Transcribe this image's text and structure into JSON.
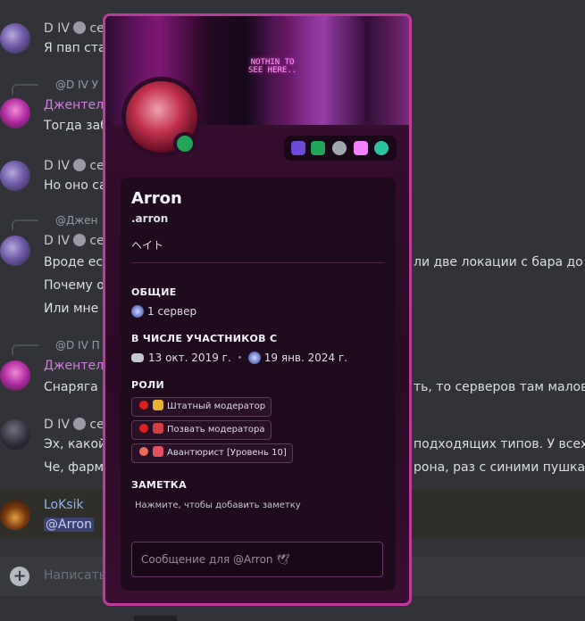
{
  "chat": {
    "messages": [
      {
        "user": "D IV",
        "suffix": "се",
        "text": "Я пвп ста"
      },
      {
        "reply": "@D IV У",
        "user": "Джентель",
        "text": "Тогда заб"
      },
      {
        "user": "D IV",
        "suffix": "се",
        "text": "Но оно са"
      },
      {
        "reply": "@Джен",
        "user": "D IV",
        "suffix": "се",
        "lines": [
          "Вроде ест",
          "Почему о",
          "Или мне н"
        ],
        "right_text": "ли две локации с бара до м"
      },
      {
        "reply": "@D IV П",
        "user": "Джентель",
        "text": "Снаряга с",
        "right_text": "ть, то серверов там маловат"
      },
      {
        "user": "D IV",
        "suffix": "се",
        "lines": [
          "Эх, какой",
          "Че, фарми"
        ],
        "right_lines": [
          "подходящих типов. У всех с",
          "рона, раз с синими пушками"
        ]
      },
      {
        "user": "LoKsik",
        "mention": "@Arron"
      }
    ],
    "composer_placeholder": "Написать"
  },
  "profile": {
    "banner_text": "NOTHIN TO\nSEE HERE..",
    "display_name": "Arron",
    "username": ".arron",
    "custom_status": "ヘイト",
    "sections": {
      "general": "ОБЩИЕ",
      "member_since": "В ЧИСЛЕ УЧАСТНИКОВ С",
      "roles": "РОЛИ",
      "note": "ЗАМЕТКА"
    },
    "mutual_servers": "1 сервер",
    "discord_since": "13 окт. 2019 г.",
    "server_since": "19 янв. 2024 г.",
    "roles": [
      {
        "name": "Штатный модератор",
        "color": "#e01e1e",
        "emoji": "crown-icon"
      },
      {
        "name": "Позвать модератора",
        "color": "#e01e1e",
        "emoji": "phone-icon"
      },
      {
        "name": "Авантюрист [Уровень 10]",
        "color": "#f06a5a",
        "emoji": "backpack-icon"
      }
    ],
    "note_placeholder": "Нажмите, чтобы добавить заметку",
    "message_placeholder": "Сообщение для @Arron 🕊"
  },
  "colors": {
    "card_border": "#c0399c",
    "online": "#23a559"
  }
}
